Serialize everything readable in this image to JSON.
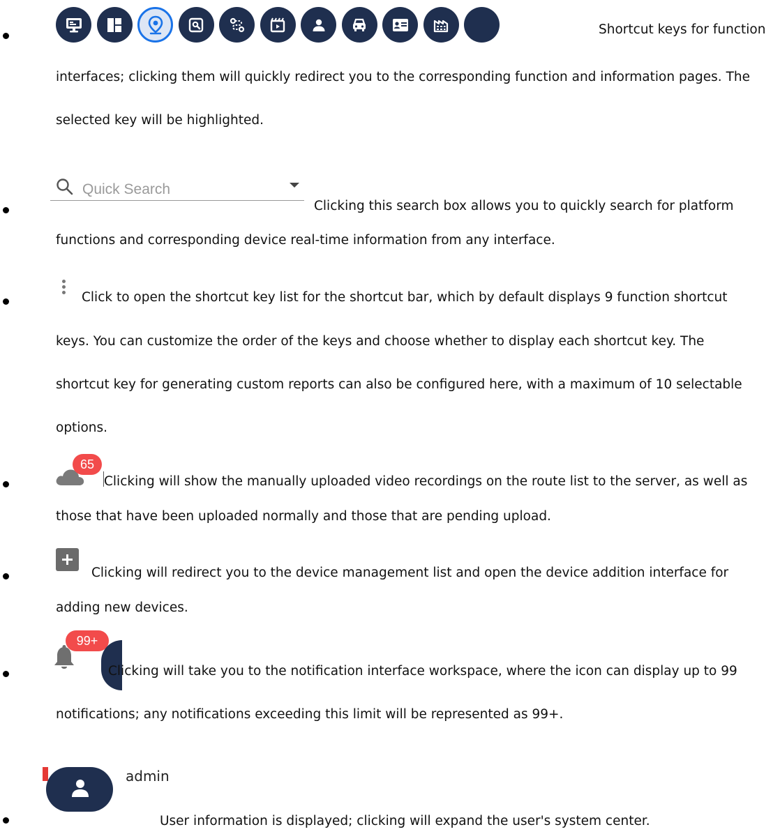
{
  "shortcut_bar": {
    "icons": [
      "monitor-icon",
      "dashboard-icon",
      "map-pin-icon",
      "face-scan-icon",
      "route-icon",
      "video-clip-icon",
      "user-icon",
      "car-icon",
      "id-card-icon",
      "factory-icon",
      "blank-icon"
    ],
    "active_index": 2,
    "description": "Shortcut keys for function interfaces; clicking them will quickly redirect you to the corresponding function and information pages. The selected key will be highlighted.",
    "line1": "Shortcut keys for function",
    "line2": "interfaces; clicking them will quickly redirect you to the corresponding function and information pages. The",
    "line3": "selected key will be highlighted."
  },
  "quick_search": {
    "placeholder": "Quick Search",
    "line1": "Clicking this search box allows you to quickly search for platform",
    "line2": "functions and corresponding device real-time information from any interface."
  },
  "more_menu": {
    "line1": "Click to open the shortcut key list for the shortcut bar, which by default displays 9 function shortcut",
    "line2": "keys. You can customize the order of the keys and choose whether to display each shortcut key. The",
    "line3": "shortcut key for generating custom reports can also be configured here, with a maximum of 10 selectable",
    "line4": "options."
  },
  "cloud_upload": {
    "badge": "65",
    "line1": "Clicking will show the manually uploaded video recordings on the route list to the server, as well as",
    "line2": "those that have been uploaded normally and those that are pending upload."
  },
  "add_device": {
    "line1": "Clicking will redirect you to the device management list and open the device addition interface for",
    "line2": "adding new devices."
  },
  "notifications": {
    "badge": "99+",
    "line1": "Clicking will take you to the notification interface workspace, where the icon can display up to 99",
    "line2": "notifications; any notifications exceeding this limit will be represented as 99+."
  },
  "user": {
    "name": "admin",
    "line1": "User information is displayed; clicking will expand the user's system center."
  },
  "colors": {
    "icon_bg": "#1f2f4f",
    "active_border": "#1a73e8",
    "badge_red": "#f24b4b"
  }
}
